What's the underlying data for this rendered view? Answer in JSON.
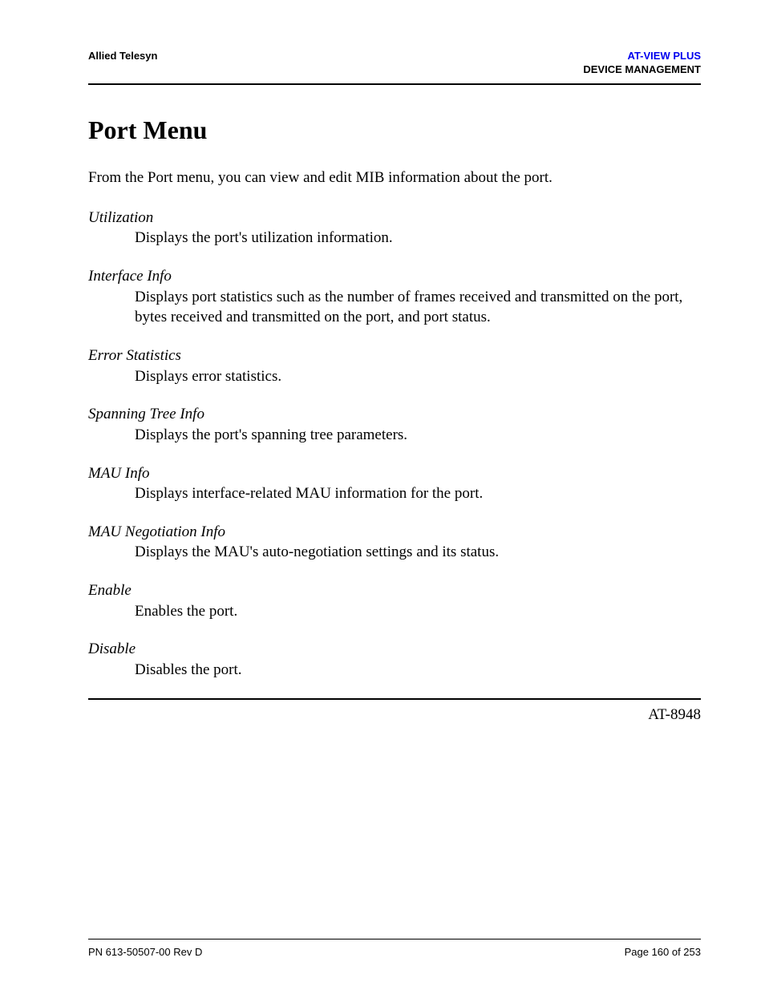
{
  "header": {
    "left": "Allied Telesyn",
    "right_line1": "AT-VIEW PLUS",
    "right_line2": "DEVICE MANAGEMENT"
  },
  "title": "Port Menu",
  "intro": "From the Port menu, you can view and edit MIB information about the port.",
  "definitions": [
    {
      "term": "Utilization",
      "desc": "Displays the port's utilization information."
    },
    {
      "term": "Interface Info",
      "desc": "Displays port statistics such as the number of frames received and transmitted on the port, bytes received and transmitted on the port, and port status."
    },
    {
      "term": "Error Statistics",
      "desc": "Displays error statistics."
    },
    {
      "term": "Spanning Tree Info",
      "desc": "Displays the port's spanning tree parameters."
    },
    {
      "term": "MAU Info",
      "desc": "Displays interface-related MAU information for the port."
    },
    {
      "term": "MAU Negotiation Info",
      "desc": "Displays the MAU's auto-negotiation settings and its status."
    },
    {
      "term": "Enable",
      "desc": "Enables the port."
    },
    {
      "term": "Disable",
      "desc": "Disables the port."
    }
  ],
  "device_model": "AT-8948",
  "footer": {
    "left": "PN 613-50507-00 Rev D",
    "right": "Page 160 of 253"
  }
}
